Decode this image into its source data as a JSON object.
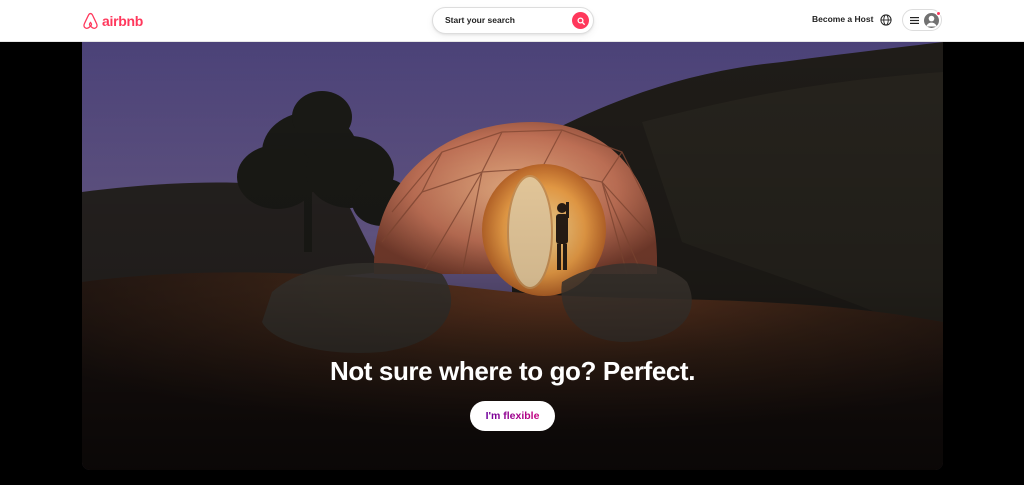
{
  "header": {
    "logo_text": "airbnb",
    "search_placeholder": "Start your search",
    "become_host": "Become a Host"
  },
  "hero": {
    "title": "Not sure where to go? Perfect.",
    "cta_label": "I'm flexible"
  },
  "icons": {
    "logo": "airbnb-belo-icon",
    "search": "search-icon",
    "globe": "globe-icon",
    "menu": "hamburger-icon",
    "profile": "avatar-icon"
  },
  "colors": {
    "brand": "#ff385c",
    "cta_gradient_start": "#6f019c",
    "cta_gradient_end": "#c6017e",
    "page_background": "#000000"
  }
}
